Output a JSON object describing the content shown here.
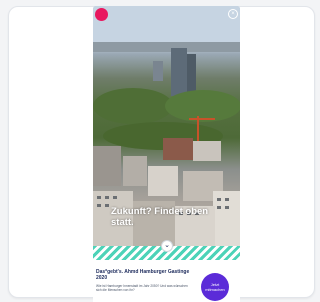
{
  "story": {
    "logo_text": "",
    "headline": "Zukunft? Findet oben statt.",
    "article_title": "Das*gebt's. Ahmd Hamburger Gastinge 2020",
    "article_text": "Wie ist Hamburger Innenstadt im Jahr 2050? Und was wünschen sich die Menschen von ihr?",
    "badge_text": "Jetzt mitmachen",
    "accent_color": "#e8185f",
    "stripe_color": "#4dd3b8",
    "badge_color": "#5b2bd8",
    "close_icon": "close-icon",
    "down_icon": "chevron-down-icon"
  }
}
